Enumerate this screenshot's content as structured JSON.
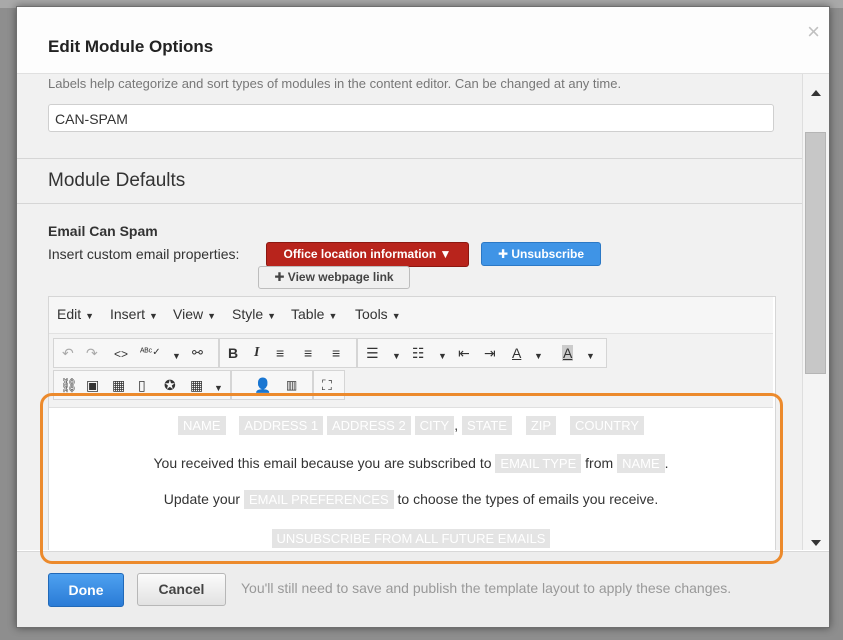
{
  "modal": {
    "title": "Edit Module Options",
    "close_glyph": "×"
  },
  "labels": {
    "help_text": "Labels help categorize and sort types of modules in the content editor. Can be changed at any time.",
    "value": "CAN-SPAM"
  },
  "section": {
    "title": "Module Defaults"
  },
  "field": {
    "title": "Email Can Spam",
    "insert_label": "Insert custom email properties:",
    "office_button": "Office location information ▼",
    "unsubscribe_button": "✚ Unsubscribe",
    "webpage_button": "✚ View webpage link"
  },
  "editor": {
    "menus": [
      {
        "label": "Edit"
      },
      {
        "label": "Insert"
      },
      {
        "label": "View"
      },
      {
        "label": "Style"
      },
      {
        "label": "Table"
      },
      {
        "label": "Tools"
      }
    ],
    "content": {
      "address_tags": [
        "NAME",
        "ADDRESS 1",
        "ADDRESS 2",
        "CITY",
        "STATE",
        "ZIP",
        "COUNTRY"
      ],
      "comma": ",",
      "line2_prefix": "You received this email because you are subscribed to",
      "line2_tag1": "EMAIL TYPE",
      "line2_mid": "from",
      "line2_tag2": "NAME",
      "line2_suffix": ".",
      "line3_prefix": "Update your",
      "line3_tag": "EMAIL PREFERENCES",
      "line3_suffix": "to choose the types of emails you receive.",
      "line4_tag": "UNSUBSCRIBE FROM ALL FUTURE EMAILS"
    }
  },
  "footer": {
    "done": "Done",
    "cancel": "Cancel",
    "note": "You'll still need to save and publish the template layout to apply these changes."
  },
  "colors": {
    "accent_blue": "#3f94e6",
    "accent_red": "#b8241c",
    "highlight_orange": "#ec8a2c",
    "tag_gray": "#e4e4e4"
  }
}
